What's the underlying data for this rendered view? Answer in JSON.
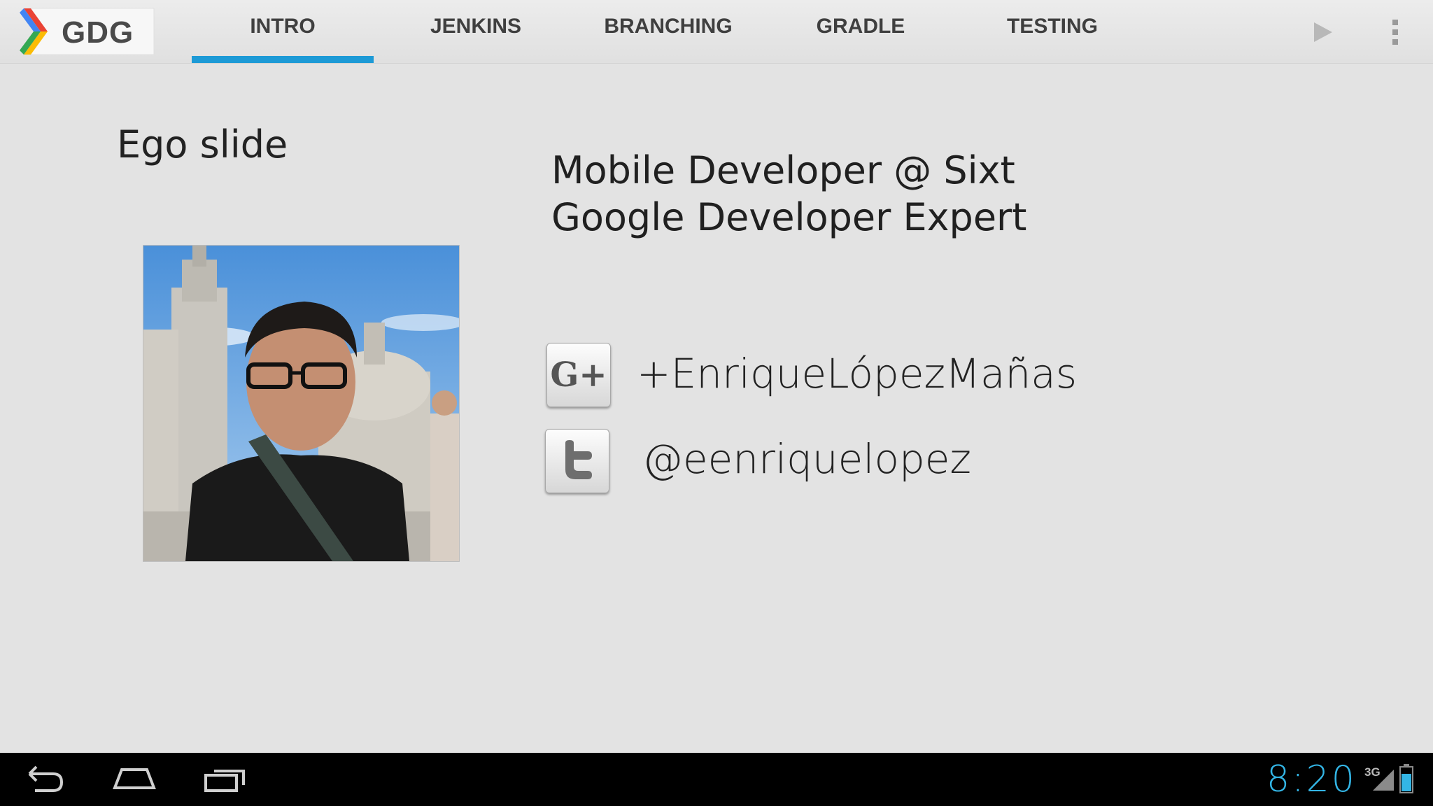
{
  "app": {
    "logo_text": "GDG"
  },
  "tabs": [
    {
      "label": "INTRO",
      "active": true
    },
    {
      "label": "JENKINS",
      "active": false
    },
    {
      "label": "BRANCHING",
      "active": false
    },
    {
      "label": "GRADLE",
      "active": false
    },
    {
      "label": "TESTING",
      "active": false
    }
  ],
  "actions": {
    "play_icon": "play-icon",
    "overflow_icon": "overflow-menu-icon"
  },
  "slide": {
    "title": "Ego slide",
    "roles": [
      "Mobile Developer @ Sixt",
      "Google Developer Expert"
    ],
    "photo_icon": "profile-photo",
    "social": [
      {
        "icon": "google-plus-icon",
        "text": "+EnriqueLópezMañas"
      },
      {
        "icon": "twitter-icon",
        "text": "@eenriquelopez"
      }
    ]
  },
  "system": {
    "clock": "8:20",
    "network": "3G",
    "accent": "#33b5e5",
    "tab_indicator": "#1d9ad6"
  }
}
